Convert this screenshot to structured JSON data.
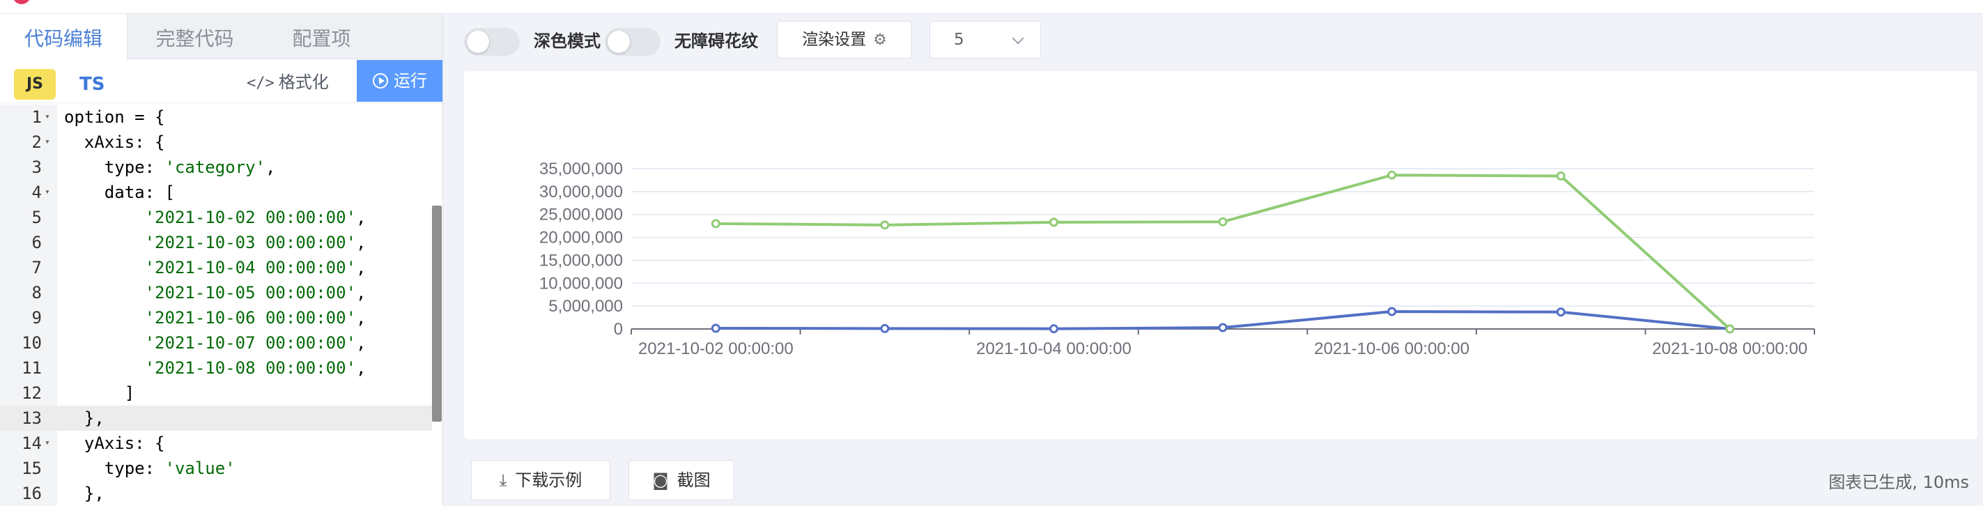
{
  "tabs": [
    {
      "label": "代码编辑"
    },
    {
      "label": "完整代码"
    },
    {
      "label": "配置项"
    }
  ],
  "lang": {
    "js": "JS",
    "ts": "TS"
  },
  "editor_toolbar": {
    "format_label": "格式化",
    "run_label": "运行"
  },
  "code_lines": [
    {
      "n": "1",
      "text": "option = {"
    },
    {
      "n": "2",
      "text": "  xAxis: {"
    },
    {
      "n": "3",
      "text": "    type: 'category',"
    },
    {
      "n": "4",
      "text": "    data: ["
    },
    {
      "n": "5",
      "text": "        '2021-10-02 00:00:00',"
    },
    {
      "n": "6",
      "text": "        '2021-10-03 00:00:00',"
    },
    {
      "n": "7",
      "text": "        '2021-10-04 00:00:00',"
    },
    {
      "n": "8",
      "text": "        '2021-10-05 00:00:00',"
    },
    {
      "n": "9",
      "text": "        '2021-10-06 00:00:00',"
    },
    {
      "n": "10",
      "text": "        '2021-10-07 00:00:00',"
    },
    {
      "n": "11",
      "text": "        '2021-10-08 00:00:00',"
    },
    {
      "n": "12",
      "text": "      ]"
    },
    {
      "n": "13",
      "text": "  },"
    },
    {
      "n": "14",
      "text": "  yAxis: {"
    },
    {
      "n": "15",
      "text": "    type: 'value'"
    },
    {
      "n": "16",
      "text": "  },"
    }
  ],
  "toolbar": {
    "dark_mode_label": "深色模式",
    "accessible_label": "无障碍花纹",
    "render_settings_label": "渲染设置",
    "select_value": "5"
  },
  "bottom": {
    "download_label": "下载示例",
    "screenshot_label": "截图",
    "status_text": "图表已生成, 10ms"
  },
  "colors": {
    "accent": "#5b9bff",
    "series_blue": "#5470c6",
    "series_green": "#91cc75"
  },
  "icons": {
    "format": "code-icon",
    "run": "play-circle-icon",
    "render": "gear-icon",
    "download": "download-icon",
    "screenshot": "camera-icon"
  },
  "chart_data": {
    "type": "line",
    "categories": [
      "2021-10-02 00:00:00",
      "2021-10-03 00:00:00",
      "2021-10-04 00:00:00",
      "2021-10-05 00:00:00",
      "2021-10-06 00:00:00",
      "2021-10-07 00:00:00",
      "2021-10-08 00:00:00"
    ],
    "x_tick_labels": [
      "2021-10-02 00:00:00",
      "2021-10-04 00:00:00",
      "2021-10-06 00:00:00",
      "2021-10-08 00:00:00"
    ],
    "y_ticks": [
      0,
      5000000,
      10000000,
      15000000,
      20000000,
      25000000,
      30000000,
      35000000
    ],
    "y_tick_labels": [
      "0",
      "5,000,000",
      "10,000,000",
      "15,000,000",
      "20,000,000",
      "25,000,000",
      "30,000,000",
      "35,000,000"
    ],
    "ylim": [
      0,
      35000000
    ],
    "series": [
      {
        "color": "#5470c6",
        "values": [
          150000,
          100000,
          50000,
          300000,
          3800000,
          3700000,
          0
        ]
      },
      {
        "color": "#91cc75",
        "values": [
          23000000,
          22700000,
          23300000,
          23400000,
          33600000,
          33400000,
          0
        ]
      }
    ],
    "grid": true,
    "legend": "none",
    "title": "",
    "xlabel": "",
    "ylabel": ""
  }
}
